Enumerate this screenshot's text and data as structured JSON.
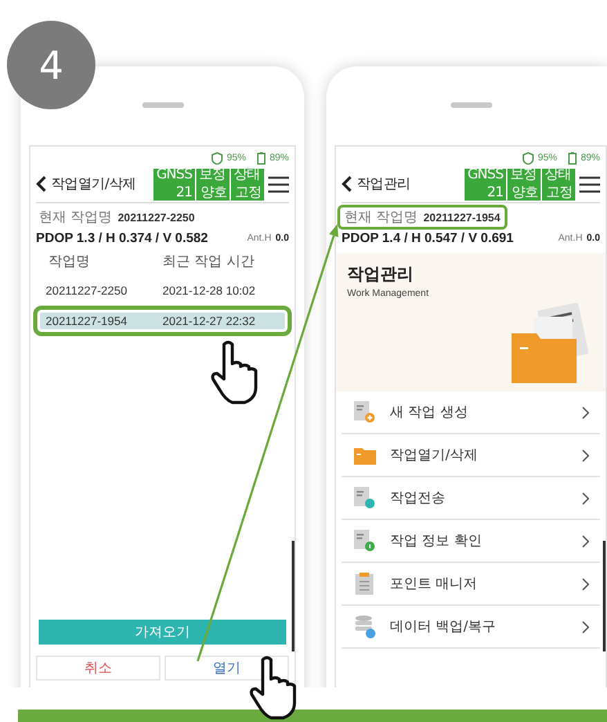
{
  "step_badge": "4",
  "phones": [
    {
      "kind": "job_list",
      "status": {
        "signal": "95%",
        "battery": "89%"
      },
      "title": "작업열기/삭제",
      "gnss": [
        {
          "label": "GNSS",
          "value": "21"
        },
        {
          "label": "보정",
          "value": "양호"
        },
        {
          "label": "상태",
          "value": "고정"
        }
      ],
      "current_job": {
        "label": "현재 작업명",
        "value": "20211227-2250",
        "highlighted": false
      },
      "pdop": "PDOP 1.3 / H 0.374 / V 0.582",
      "ant_h": {
        "label": "Ant.H",
        "value": "0.0"
      },
      "columns": [
        "작업명",
        "최근 작업 시간"
      ],
      "rows": [
        {
          "name": "20211227-2250",
          "time": "2021-12-28 10:02",
          "selected": false
        },
        {
          "name": "20211227-1954",
          "time": "2021-12-27 22:32",
          "selected": true
        }
      ],
      "import_button": "가져오기",
      "buttons": [
        {
          "label": "취소",
          "kind": "cancel"
        },
        {
          "label": "열기",
          "kind": "confirm"
        }
      ]
    },
    {
      "kind": "menu",
      "status": {
        "signal": "95%",
        "battery": "89%"
      },
      "title": "작업관리",
      "gnss": [
        {
          "label": "GNSS",
          "value": "21"
        },
        {
          "label": "보정",
          "value": "양호"
        },
        {
          "label": "상태",
          "value": "고정"
        }
      ],
      "current_job": {
        "label": "현재 작업명",
        "value": "20211227-1954",
        "highlighted": true
      },
      "pdop": "PDOP 1.4 / H 0.547 / V 0.691",
      "ant_h": {
        "label": "Ant.H",
        "value": "0.0"
      },
      "banner": {
        "title": "작업관리",
        "subtitle": "Work Management"
      },
      "menu_items": [
        {
          "label": "새 작업 생성",
          "kind": "new"
        },
        {
          "label": "작업열기/삭제",
          "kind": "open"
        },
        {
          "label": "작업전송",
          "kind": "transfer"
        },
        {
          "label": "작업 정보 확인",
          "kind": "info"
        },
        {
          "label": "포인트 매니저",
          "kind": "points"
        },
        {
          "label": "데이터 백업/복구",
          "kind": "backup"
        }
      ]
    }
  ]
}
